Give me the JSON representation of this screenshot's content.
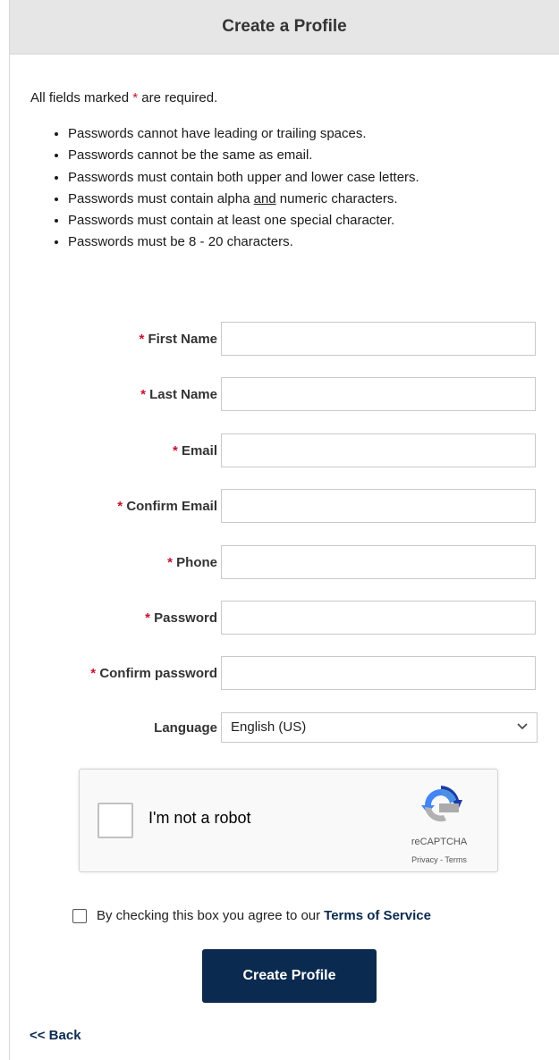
{
  "header": {
    "title": "Create a Profile"
  },
  "required_note": {
    "prefix": "All fields marked ",
    "star": "*",
    "suffix": " are required."
  },
  "password_rules": {
    "r1": "Passwords cannot have leading or trailing spaces.",
    "r2": "Passwords cannot be the same as email.",
    "r3": "Passwords must contain both upper and lower case letters.",
    "r4_pre": "Passwords must contain alpha ",
    "r4_and": "and",
    "r4_post": " numeric characters.",
    "r5": "Passwords must contain at least one special character.",
    "r6": "Passwords must be 8 - 20 characters."
  },
  "form": {
    "first_name": {
      "label": "First Name",
      "value": ""
    },
    "last_name": {
      "label": "Last Name",
      "value": ""
    },
    "email": {
      "label": "Email",
      "value": ""
    },
    "confirm_email": {
      "label": "Confirm Email",
      "value": ""
    },
    "phone": {
      "label": "Phone",
      "value": ""
    },
    "password": {
      "label": "Password",
      "value": ""
    },
    "confirm_password": {
      "label": "Confirm password",
      "value": ""
    },
    "language": {
      "label": "Language",
      "value": "English (US)"
    },
    "required_star": "*"
  },
  "captcha": {
    "label": "I'm not a robot",
    "brand": "reCAPTCHA",
    "links": "Privacy - Terms"
  },
  "agree": {
    "text": "By checking this box you agree to our",
    "link": "Terms of Service"
  },
  "submit_label": "Create Profile",
  "back_label": "<< Back",
  "colors": {
    "accent": "#0b2a4f",
    "required": "#c8102e",
    "header_bg": "#e6e6e6"
  }
}
